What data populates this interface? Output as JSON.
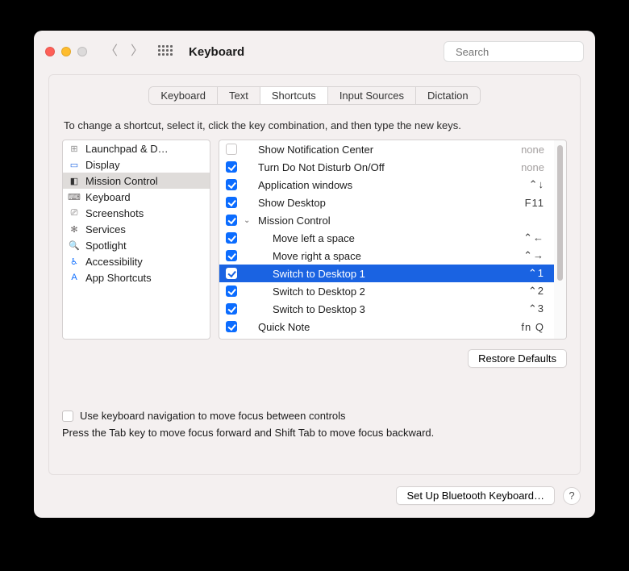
{
  "window": {
    "title": "Keyboard"
  },
  "search": {
    "placeholder": "Search"
  },
  "tabs": [
    "Keyboard",
    "Text",
    "Shortcuts",
    "Input Sources",
    "Dictation"
  ],
  "active_tab": 2,
  "instruction": "To change a shortcut, select it, click the key combination, and then type the new keys.",
  "categories": [
    {
      "label": "Launchpad & D…",
      "icon": "launchpad",
      "color": "#8e8e8e"
    },
    {
      "label": "Display",
      "icon": "display",
      "color": "#1a63e2"
    },
    {
      "label": "Mission Control",
      "icon": "mission",
      "color": "#333",
      "selected": true
    },
    {
      "label": "Keyboard",
      "icon": "keyboard",
      "color": "#6b6767"
    },
    {
      "label": "Screenshots",
      "icon": "screenshot",
      "color": "#6b6767"
    },
    {
      "label": "Services",
      "icon": "services",
      "color": "#6b6767"
    },
    {
      "label": "Spotlight",
      "icon": "spotlight",
      "color": "#6b6767"
    },
    {
      "label": "Accessibility",
      "icon": "accessibility",
      "color": "#0b6cff"
    },
    {
      "label": "App Shortcuts",
      "icon": "app",
      "color": "#0b6cff"
    }
  ],
  "shortcuts": [
    {
      "checked": false,
      "label": "Show Notification Center",
      "key": "none",
      "indent": 0,
      "keynone": true
    },
    {
      "checked": true,
      "label": "Turn Do Not Disturb On/Off",
      "key": "none",
      "indent": 0,
      "keynone": true
    },
    {
      "checked": true,
      "label": "Application windows",
      "key": "⌃↓",
      "indent": 0
    },
    {
      "checked": true,
      "label": "Show Desktop",
      "key": "F11",
      "indent": 0
    },
    {
      "checked": true,
      "label": "Mission Control",
      "key": "",
      "indent": 0,
      "disclosure": "open"
    },
    {
      "checked": true,
      "label": "Move left a space",
      "key": "⌃←",
      "indent": 1
    },
    {
      "checked": true,
      "label": "Move right a space",
      "key": "⌃→",
      "indent": 1
    },
    {
      "checked": true,
      "label": "Switch to Desktop 1",
      "key": "⌃1",
      "indent": 1,
      "selected": true
    },
    {
      "checked": true,
      "label": "Switch to Desktop 2",
      "key": "⌃2",
      "indent": 1
    },
    {
      "checked": true,
      "label": "Switch to Desktop 3",
      "key": "⌃3",
      "indent": 1
    },
    {
      "checked": true,
      "label": "Quick Note",
      "key": "fn Q",
      "indent": 0
    }
  ],
  "restore_label": "Restore Defaults",
  "kb_nav": {
    "label": "Use keyboard navigation to move focus between controls",
    "hint": "Press the Tab key to move focus forward and Shift Tab to move focus backward."
  },
  "footer": {
    "bluetooth": "Set Up Bluetooth Keyboard…"
  }
}
